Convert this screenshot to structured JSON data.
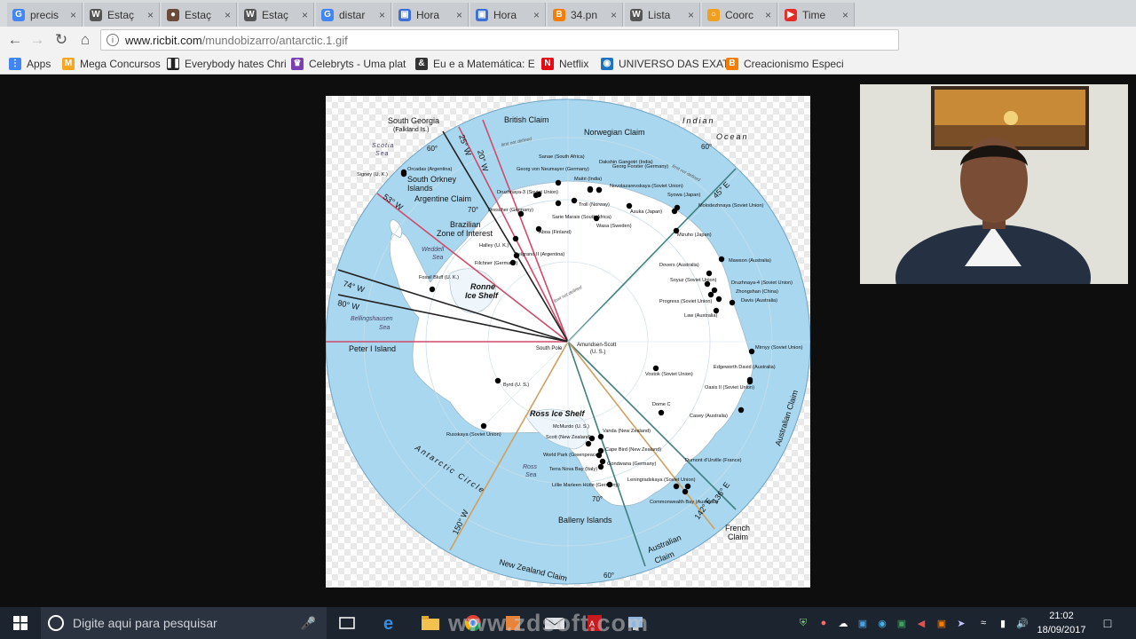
{
  "browser": {
    "tabs": [
      {
        "label": "precis",
        "icon": "google-icon",
        "color": "#4285f4",
        "glyph": "G"
      },
      {
        "label": "Estaç",
        "icon": "wikipedia-icon",
        "color": "#555555",
        "glyph": "W"
      },
      {
        "label": "Estaç",
        "icon": "site-icon",
        "color": "#6b4a3a",
        "glyph": "●"
      },
      {
        "label": "Estaç",
        "icon": "wikipedia-icon",
        "color": "#555555",
        "glyph": "W"
      },
      {
        "label": "distar",
        "icon": "google-icon",
        "color": "#4285f4",
        "glyph": "G"
      },
      {
        "label": "Hora",
        "icon": "page-icon",
        "color": "#3b6fd6",
        "glyph": "▣"
      },
      {
        "label": "Hora",
        "icon": "page-icon",
        "color": "#3b6fd6",
        "glyph": "▣"
      },
      {
        "label": "34.pn",
        "icon": "blogger-icon",
        "color": "#f57d00",
        "glyph": "B"
      },
      {
        "label": "Lista",
        "icon": "wikipedia-icon",
        "color": "#555555",
        "glyph": "W"
      },
      {
        "label": "Coorc",
        "icon": "site-icon",
        "color": "#f0a020",
        "glyph": "○"
      },
      {
        "label": "Time",
        "icon": "youtube-icon",
        "color": "#e52d27",
        "glyph": "▶"
      }
    ],
    "url_host": "www.ricbit.com",
    "url_path": "/mundobizarro/antarctic.1.gif",
    "bookmarks": [
      {
        "label": "Apps",
        "icon": "apps-icon",
        "color": "#4285f4",
        "glyph": "⋮"
      },
      {
        "label": "Mega Concursos",
        "icon": "mega-concursos-icon",
        "color": "#f5a623",
        "glyph": "M"
      },
      {
        "label": "Everybody hates Chri",
        "icon": "pause-icon",
        "color": "#222222",
        "glyph": "❚❚"
      },
      {
        "label": "Celebryts - Uma plat",
        "icon": "crown-icon",
        "color": "#7a3fb0",
        "glyph": "♛"
      },
      {
        "label": "Eu e a Matemática: E",
        "icon": "ampersand-icon",
        "color": "#333333",
        "glyph": "&"
      },
      {
        "label": "Netflix",
        "icon": "netflix-icon",
        "color": "#e50914",
        "glyph": "N"
      },
      {
        "label": "UNIVERSO DAS EXAT",
        "icon": "globe-icon",
        "color": "#1e73be",
        "glyph": "◉"
      },
      {
        "label": "Creacionismo Especi",
        "icon": "blogger-icon",
        "color": "#f57d00",
        "glyph": "B"
      }
    ]
  },
  "map": {
    "title_regions": {
      "south_georgia": "South Georgia",
      "falkland": "(Falkland Is.)",
      "british": "British Claim",
      "norwegian": "Norwegian Claim",
      "indian_ocean_1": "Indian",
      "indian_ocean_2": "Ocean",
      "scotia_1": "Scotia",
      "scotia_2": "Sea",
      "south_orkney_1": "South Orkney",
      "south_orkney_2": "Islands",
      "argentine": "Argentine Claim",
      "brazilian_1": "Brazilian",
      "brazilian_2": "Zone of Interest",
      "weddell_1": "Weddell",
      "weddell_2": "Sea",
      "ronne_1": "Ronne",
      "ronne_2": "Ice Shelf",
      "bellingshausen_1": "Bellingshausen",
      "bellingshausen_2": "Sea",
      "peter_i": "Peter I Island",
      "south_pole": "South Pole",
      "amundsen_1": "Amundsen-Scott",
      "amundsen_2": "(U. S.)",
      "ross_ice_shelf": "Ross Ice Shelf",
      "ross_sea_1": "Ross",
      "ross_sea_2": "Sea",
      "antarctic_circle": "Antarctic Circle",
      "balleny": "Balleny Islands",
      "new_zealand": "New Zealand Claim",
      "australian_1": "Australian",
      "australian_2": "Claim",
      "australian_claim_right": "Australian Claim",
      "french_1": "French",
      "french_2": "Claim",
      "limit_not_defined": "limit not defined"
    },
    "meridians": {
      "w20": "20° W",
      "w25": "25° W",
      "w53": "53° W",
      "w74": "74° W",
      "w80": "80° W",
      "w150": "150° W",
      "e45": "45° E",
      "e136": "136° E",
      "e142": "142° E",
      "lat60_a": "60°",
      "lat60_b": "60°",
      "lat60_c": "60°",
      "lat70_a": "70°",
      "lat70_b": "70°"
    },
    "stations": [
      {
        "name": "Signey (U. K.)"
      },
      {
        "name": "Orcadas (Argentina)"
      },
      {
        "name": "Sanae (South Africa)"
      },
      {
        "name": "Georg von Neumayer (Germany)"
      },
      {
        "name": "Dakshin Gangotri (India)"
      },
      {
        "name": "Maitri (India)"
      },
      {
        "name": "Georg Forster (Germany)"
      },
      {
        "name": "Novolazarevskaya (Soviet Union)"
      },
      {
        "name": "Druzhnaya-3 (Soviet Union)"
      },
      {
        "name": "Troll (Norway)"
      },
      {
        "name": "Syowa (Japan)"
      },
      {
        "name": "Drescher (Germany)"
      },
      {
        "name": "Asuka (Japan)"
      },
      {
        "name": "Molodezhnaya (Soviet Union)"
      },
      {
        "name": "Sarie Marais (South Africa)"
      },
      {
        "name": "Wasa (Sweden)"
      },
      {
        "name": "Aboa (Finland)"
      },
      {
        "name": "Mizuho (Japan)"
      },
      {
        "name": "Halley (U. K.)"
      },
      {
        "name": "Belgrano II (Argentina)"
      },
      {
        "name": "Mawson (Australia)"
      },
      {
        "name": "Filchner (Germany)"
      },
      {
        "name": "Dovers (Australia)"
      },
      {
        "name": "Soyuz (Soviet Union)"
      },
      {
        "name": "Druzhnaya-4 (Soviet Union)"
      },
      {
        "name": "Zhongshan (China)"
      },
      {
        "name": "Progress (Soviet Union)"
      },
      {
        "name": "Davis (Australia)"
      },
      {
        "name": "Law (Australia)"
      },
      {
        "name": "Fossil Bluff (U. K.)"
      },
      {
        "name": "Mirnyy (Soviet Union)"
      },
      {
        "name": "Edgeworth David (Australia)"
      },
      {
        "name": "Vostok (Soviet Union)"
      },
      {
        "name": "Oasis II (Soviet Union)"
      },
      {
        "name": "Byrd (U. S.)"
      },
      {
        "name": "Dome C"
      },
      {
        "name": "Casey (Australia)"
      },
      {
        "name": "McMurdo (U. S.)"
      },
      {
        "name": "Vanda (New Zealand)"
      },
      {
        "name": "Scott (New Zealand)"
      },
      {
        "name": "Russkaya (Soviet Union)"
      },
      {
        "name": "Cape Bird (New Zealand)"
      },
      {
        "name": "World Park (Greenpeace)"
      },
      {
        "name": "Dumont d'Urville (France)"
      },
      {
        "name": "Gondwana (Germany)"
      },
      {
        "name": "Terra Nova Bay (Italy)"
      },
      {
        "name": "Leningradskaya (Soviet Union)"
      },
      {
        "name": "Lillie Marleen Hütte (Germany)"
      },
      {
        "name": "Commonwealth Bay (Australia)"
      }
    ]
  },
  "taskbar": {
    "search_placeholder": "Digite aqui para pesquisar",
    "watermark": "www.zdsoft.com",
    "time": "21:02",
    "date": "18/09/2017"
  }
}
